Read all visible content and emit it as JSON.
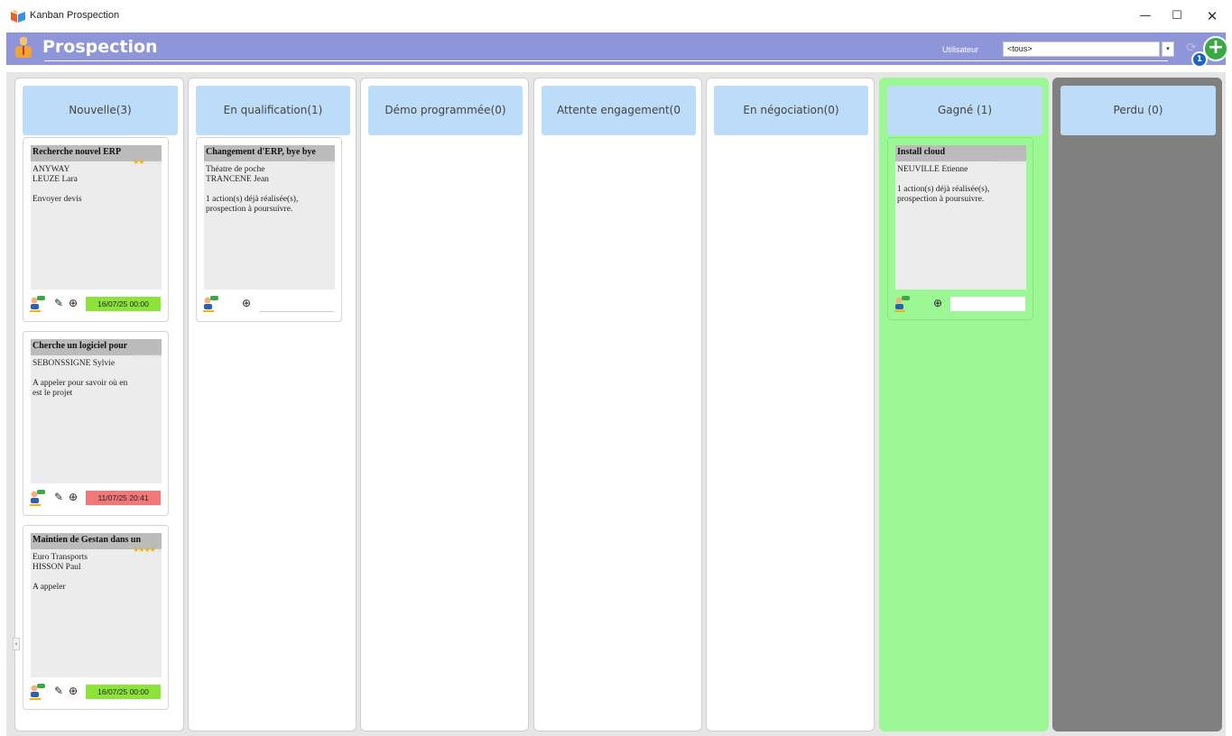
{
  "window": {
    "title": "Kanban Prospection",
    "minimize_glyph": "—",
    "maximize_glyph": "☐",
    "close_glyph": "✕",
    "icon": "kanban-app-icon"
  },
  "header": {
    "title": "Prospection",
    "icon": "person-with-tie-icon",
    "user_label": "Utilisateur",
    "user_value": "<tous>",
    "user_dropdown_glyph": "▾",
    "refresh_glyph": "⟳",
    "add_glyph": "+",
    "badge_count": "1",
    "accent_color": "#8e95d9"
  },
  "columns": [
    {
      "label": "Nouvelle(3)",
      "cards": [
        {
          "title": "Recherche nouvel ERP",
          "stars": [
            "★",
            "★",
            "☆",
            "☆",
            "☆"
          ],
          "lines": [
            "ANYWAY",
            "LEUZE Lara",
            "",
            "Envoyer devis"
          ],
          "pencil": "✎",
          "plus": "⊕",
          "date": "16/07/25 00:00",
          "date_status": "green"
        },
        {
          "title": "Cherche un logiciel pour",
          "stars": [
            "☆",
            "☆",
            "☆",
            "☆",
            "☆"
          ],
          "lines": [
            "SEBONSSIGNE Sylvie",
            "",
            "A appeler pour savoir où en",
            "est le projet"
          ],
          "pencil": "✎",
          "plus": "⊕",
          "date": "11/07/25 20:41",
          "date_status": "red"
        },
        {
          "title": "Maintien de Gestan dans un",
          "stars": [
            "★",
            "★",
            "★",
            "★",
            "☆"
          ],
          "lines": [
            "Euro Transports",
            "HISSON Paul",
            "",
            "A appeler"
          ],
          "pencil": "✎",
          "plus": "⊕",
          "date": "16/07/25 00:00",
          "date_status": "green"
        }
      ]
    },
    {
      "label": "En qualification(1)",
      "cards": [
        {
          "title": "Changement d'ERP, bye bye",
          "stars": [
            "☆",
            "☆",
            "☆",
            "☆",
            "☆"
          ],
          "lines": [
            "Théatre de poche",
            "TRANCENE Jean",
            "",
            "1 action(s) déjà réalisée(s),",
            "prospection à poursuivre."
          ],
          "pencil": "",
          "plus": "⊕",
          "date": "",
          "date_status": "none"
        }
      ]
    },
    {
      "label": "Démo programmée(0)",
      "cards": []
    },
    {
      "label": "Attente engagement(0",
      "cards": []
    },
    {
      "label": "En négociation(0)",
      "cards": []
    },
    {
      "label": "Gagné (1)",
      "cards": [
        {
          "title": "Install cloud",
          "stars": [
            "☆",
            "☆",
            "☆",
            "☆",
            "☆"
          ],
          "lines": [
            "NEUVILLE Etienne",
            "",
            "1 action(s) déjà réalisée(s),",
            "prospection à poursuivre."
          ],
          "pencil": "",
          "plus": "⊕",
          "date": "",
          "date_status": "empty"
        }
      ]
    },
    {
      "label": "Perdu (0)",
      "cards": []
    }
  ],
  "colors": {
    "column_header": "#bcdcf7",
    "won_column": "#9cf894",
    "lost_column": "#808080",
    "date_green": "#8ee33b",
    "date_red": "#f17878",
    "star_on": "#f2b300"
  },
  "left_tab_glyph": "‹"
}
